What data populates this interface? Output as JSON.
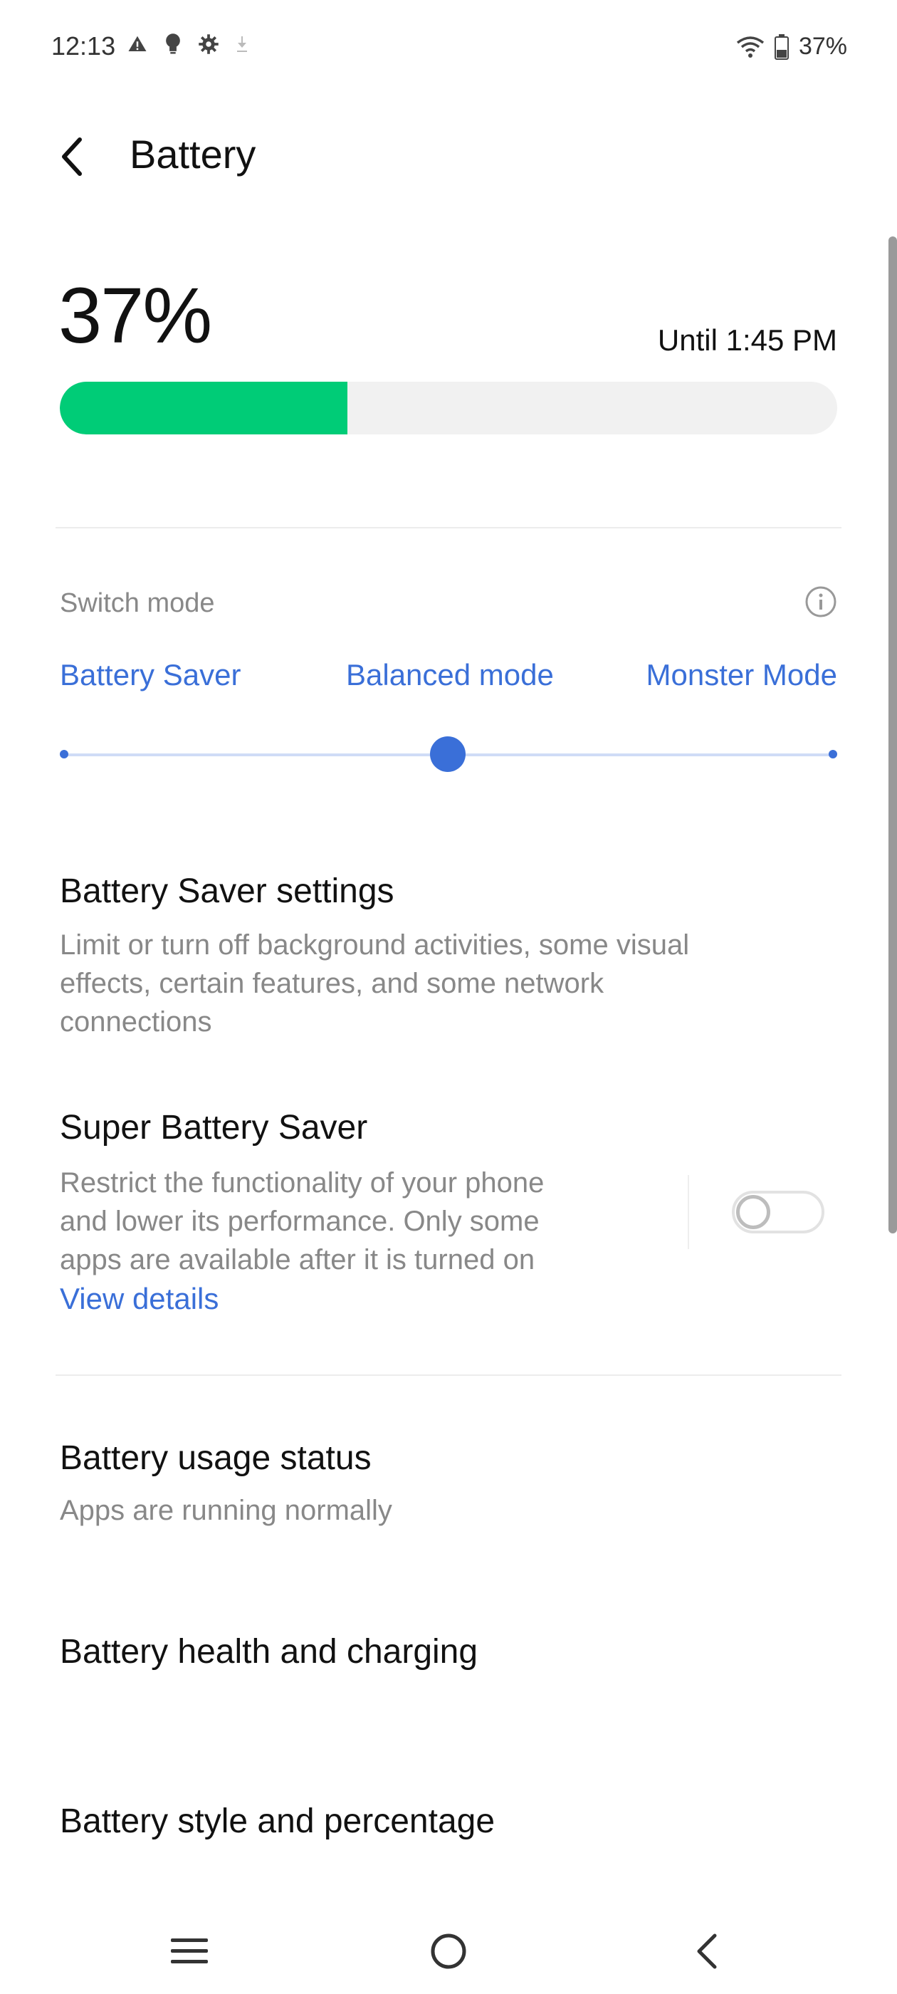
{
  "status": {
    "time": "12:13",
    "battery_pct": "37%",
    "left_icons": [
      "warning-icon",
      "bulb-icon",
      "gear-icon",
      "download-icon"
    ],
    "right_icons": [
      "wifi-icon",
      "battery-icon"
    ]
  },
  "header": {
    "title": "Battery",
    "back_icon": "chevron-left-icon"
  },
  "summary": {
    "percent": "37%",
    "until": "Until 1:45 PM",
    "level": 0.37,
    "bar_color": "#00cc77"
  },
  "switch_mode": {
    "label": "Switch mode",
    "modes": [
      "Battery Saver",
      "Balanced mode",
      "Monster Mode"
    ],
    "selected_index": 1,
    "accent": "#3a6fd8"
  },
  "items": {
    "saver_title": "Battery Saver settings",
    "saver_desc_1": "Limit or turn off background activities, some visual",
    "saver_desc_2": "effects, certain features, and some network",
    "saver_desc_3": "connections",
    "super_title": "Super Battery Saver",
    "super_desc_1": "Restrict the functionality of your phone",
    "super_desc_2": "and lower its performance. Only some",
    "super_desc_3": "apps are available after it is turned on",
    "super_link": "View details",
    "super_toggle_on": false,
    "usage_title": "Battery usage status",
    "usage_desc": "Apps are running normally",
    "health_title": "Battery health and charging",
    "style_title": "Battery style and percentage"
  },
  "nav": {
    "icons": [
      "menu-icon",
      "home-icon",
      "back-icon"
    ]
  }
}
